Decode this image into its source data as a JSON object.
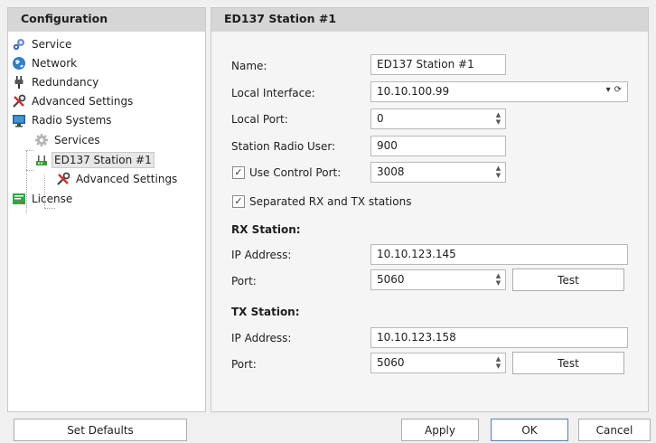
{
  "left_panel": {
    "header": "Configuration",
    "tree": [
      {
        "label": "Service",
        "icon": "gears-icon"
      },
      {
        "label": "Network",
        "icon": "globe-icon"
      },
      {
        "label": "Redundancy",
        "icon": "plug-icon"
      },
      {
        "label": "Advanced Settings",
        "icon": "tools-icon"
      },
      {
        "label": "Radio Systems",
        "icon": "monitor-icon"
      },
      {
        "label": "Services",
        "icon": "gear-icon"
      },
      {
        "label": "ED137 Station #1",
        "icon": "radio-station-icon"
      },
      {
        "label": "Advanced Settings",
        "icon": "tools-icon"
      },
      {
        "label": "License",
        "icon": "license-icon"
      }
    ]
  },
  "right_panel": {
    "header": "ED137 Station #1",
    "name_label": "Name:",
    "name_value": "ED137 Station #1",
    "local_interface_label": "Local Interface:",
    "local_interface_value": "10.10.100.99",
    "local_port_label": "Local Port:",
    "local_port_value": "0",
    "radio_user_label": "Station Radio User:",
    "radio_user_value": "900",
    "use_control_port_label": "Use Control Port:",
    "use_control_port_checked": true,
    "control_port_value": "3008",
    "separated_label": "Separated RX and TX stations",
    "separated_checked": true,
    "rx": {
      "title": "RX Station:",
      "ip_label": "IP Address:",
      "ip_value": "10.10.123.145",
      "port_label": "Port:",
      "port_value": "5060",
      "test_label": "Test"
    },
    "tx": {
      "title": "TX Station:",
      "ip_label": "IP Address:",
      "ip_value": "10.10.123.158",
      "port_label": "Port:",
      "port_value": "5060",
      "test_label": "Test"
    }
  },
  "footer": {
    "set_defaults": "Set Defaults",
    "apply": "Apply",
    "ok": "OK",
    "cancel": "Cancel"
  },
  "colors": {
    "header_bg": "#d6d6d6",
    "default_button_border": "#5b7fb5"
  }
}
